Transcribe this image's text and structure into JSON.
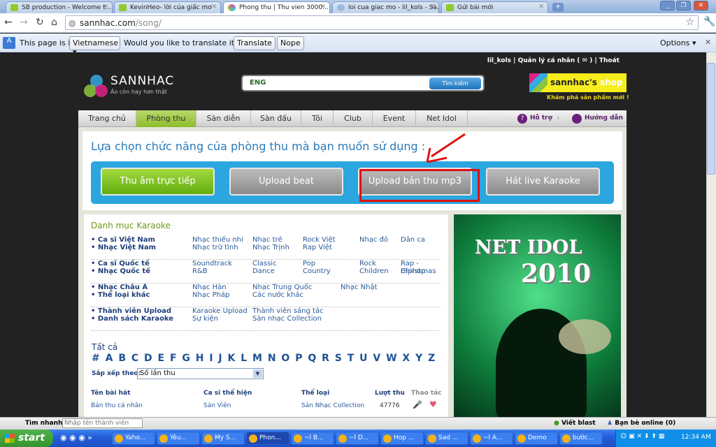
{
  "browser": {
    "tabs": [
      {
        "title": "SB production - Welcome t...",
        "active": false
      },
      {
        "title": "KevinHeo- lời của giấc mơ",
        "active": false
      },
      {
        "title": "Phong thu | Thu vien 3000...",
        "active": true
      },
      {
        "title": "loi cua giac mo - lil_kols - Sà...",
        "active": false
      },
      {
        "title": "Gửi bài mới",
        "active": false
      }
    ],
    "url_domain": "sannhac.com",
    "url_path": "/song/",
    "translate": {
      "prefix": "This page is in",
      "language": "Vietnamese",
      "question": "Would you like to translate it?",
      "translate_label": "Translate",
      "nope_label": "Nope",
      "options_label": "Options"
    }
  },
  "site": {
    "user": "lil_kols | Quản lý cá nhân ( ✉ ) | Thoát",
    "logo_title": "SANNHAC",
    "logo_slogan": "Ảo còn hay hơn thật",
    "search_value": "ENG",
    "search_button": "Tìm kiếm",
    "shop_title": "sannhac's",
    "shop_title2": "shop",
    "shop_sub": "Khám phá sản phẩm mới !",
    "nav": [
      {
        "label": "Trang chủ"
      },
      {
        "label": "Phòng thu",
        "active": true
      },
      {
        "label": "Sàn diễn"
      },
      {
        "label": "Sàn đấu"
      },
      {
        "label": "Tôi"
      },
      {
        "label": "Club"
      },
      {
        "label": "Event"
      },
      {
        "label": "Net Idol"
      }
    ],
    "help": "Hỗ trợ",
    "guide": "Hướng dẫn",
    "function_title": "Lựa chọn chức năng của phòng thu mà bạn muốn sử dụng :",
    "functions": [
      "Thu âm trực tiếp",
      "Upload beat",
      "Upload bản thu mp3",
      "Hát live Karaoke"
    ],
    "catalog_title": "Danh mục Karaoke",
    "groups": [
      {
        "left": [
          "• Ca sĩ Việt Nam",
          "• Nhạc Việt Nam"
        ],
        "cols": [
          [
            "Nhạc thiếu nhi",
            "Nhạc trữ tình"
          ],
          [
            "Nhạc trẻ",
            "Nhạc Trịnh"
          ],
          [
            "Rock Việt",
            "Rap Việt"
          ],
          [
            "Nhạc đỏ",
            ""
          ],
          [
            "Dân ca",
            ""
          ]
        ]
      },
      {
        "left": [
          "• Ca sĩ Quốc tế",
          "• Nhạc Quốc tế"
        ],
        "cols": [
          [
            "Soundtrack",
            "R&B"
          ],
          [
            "Classic",
            "Dance"
          ],
          [
            "Pop",
            "Country"
          ],
          [
            "Rock",
            "Children"
          ],
          [
            "Rap - Hiphop",
            "Chirstmas"
          ]
        ]
      },
      {
        "left": [
          "• Nhạc Châu Á",
          "• Thể loại khác"
        ],
        "cols": [
          [
            "Nhạc Hàn",
            "Nhạc Pháp"
          ],
          [
            "Nhạc Trung Quốc",
            "Các nước khác"
          ],
          [
            "",
            ""
          ],
          [
            "Nhạc Nhật",
            ""
          ],
          [
            "",
            ""
          ]
        ]
      },
      {
        "left": [
          "• Thành viên Upload",
          "• Danh sách Karaoke"
        ],
        "cols": [
          [
            "Karaoke Upload",
            "Sự kiện"
          ],
          [
            "Thành viên sáng tác",
            "Sàn nhạc Collection"
          ],
          [
            "",
            ""
          ],
          [
            "",
            ""
          ],
          [
            "",
            ""
          ]
        ]
      }
    ],
    "all_label": "Tất cả",
    "alphabet": "# A B C D E F G H I J K L M N O P Q R S T U V W X Y Z",
    "sort_label": "Sắp xếp theo:",
    "sort_value": "Số lần thu",
    "table_headers": [
      "Tên bài hát",
      "Ca sĩ thể hiện",
      "Thể loại",
      "Lượt thu",
      "Thao tác"
    ],
    "rows": [
      [
        "Bản thu cá nhân",
        "Sản Viên",
        "Sản Nhạc Collection",
        "47776"
      ]
    ],
    "ad_line1": "NET IDOL",
    "ad_line2": "2010"
  },
  "bottom": {
    "quick_label": "Tìm nhanh:",
    "quick_placeholder": "Nhập tên thành viên",
    "blast": "Viết blast",
    "friends": "Bạn bè online (0)"
  },
  "taskbar": {
    "start": "start",
    "items": [
      "Yaho...",
      "Yêu...",
      "My S...",
      "Phon...",
      "~l B...",
      "~l D...",
      "Hop ...",
      "Sad ...",
      "~l A...",
      "Demo",
      "bước..."
    ],
    "clock": "12:34 AM"
  },
  "colors": {
    "accent_green": "#8dbb2c",
    "func_blue": "#2ca6de",
    "annotation_red": "#e01010"
  }
}
